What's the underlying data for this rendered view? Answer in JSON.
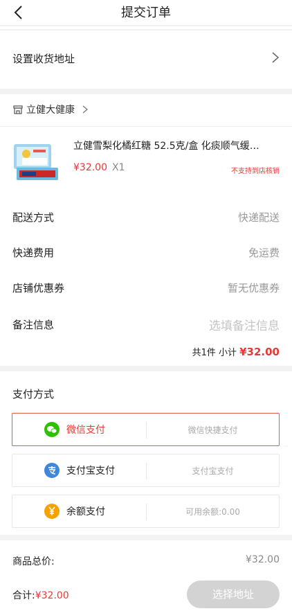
{
  "header": {
    "title": "提交订单"
  },
  "address": {
    "label": "设置收货地址"
  },
  "store": {
    "name": "立健大健康"
  },
  "product": {
    "title": "立健雪梨化橘红糖 52.5克/盒 化痰顺气缓…",
    "price": "¥32.00",
    "quantity": "X1",
    "pickup_note": "不支持到店核销"
  },
  "rows": [
    {
      "label": "配送方式",
      "value": "快递配送"
    },
    {
      "label": "快递费用",
      "value": "免运费"
    },
    {
      "label": "店铺优惠券",
      "value": "暂无优惠券"
    },
    {
      "label": "备注信息",
      "placeholder": "选填备注信息"
    }
  ],
  "subtotal": {
    "prefix": "共1件 小计",
    "price": "¥32.00"
  },
  "payment": {
    "title": "支付方式",
    "options": [
      {
        "name": "微信支付",
        "desc": "微信快捷支付",
        "color": "#2dc100"
      },
      {
        "name": "支付宝支付",
        "desc": "支付宝支付",
        "color": "#3f87d8"
      },
      {
        "name": "余额支付",
        "desc": "可用余额:0.00",
        "color": "#f5a100"
      }
    ]
  },
  "summary": {
    "goods_total_label": "商品总价:",
    "goods_total_value": "¥32.00"
  },
  "footer": {
    "total_label": "合计:",
    "total_value": "¥32.00",
    "button_label": "选择地址"
  },
  "colors": {
    "accent": "#e53935",
    "border_selected": "#e05a4f",
    "button_disabled": "#d3d3d3"
  }
}
